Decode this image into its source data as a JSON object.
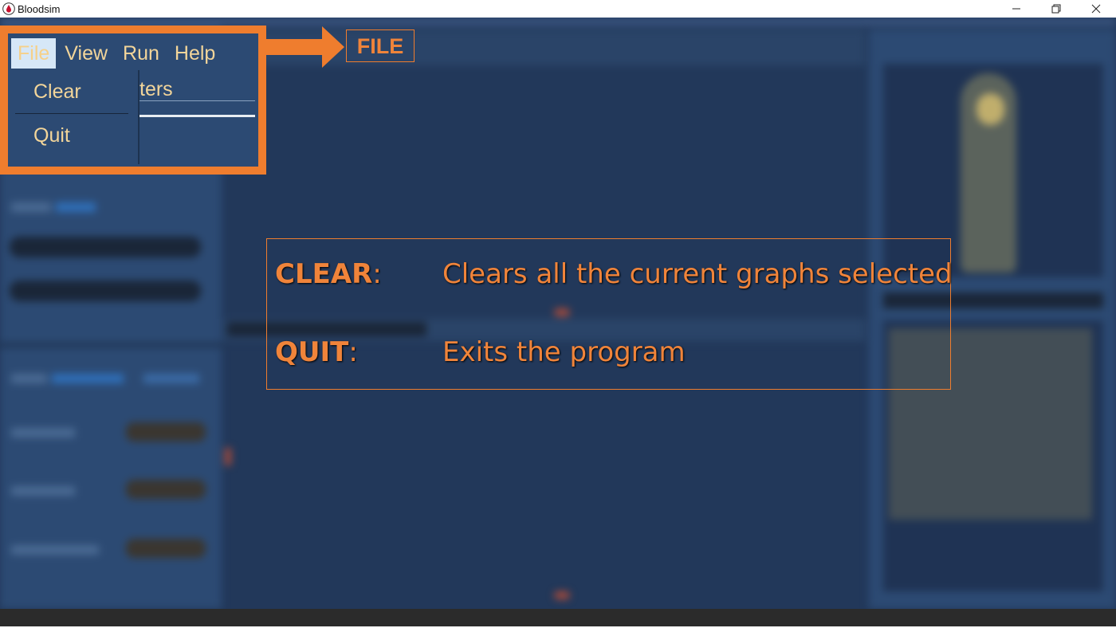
{
  "window": {
    "title": "Bloodsim",
    "controls": [
      "minimize-icon",
      "restore-icon",
      "close-icon"
    ]
  },
  "menubar": {
    "items": [
      {
        "label": "File",
        "active": true
      },
      {
        "label": "View",
        "active": false
      },
      {
        "label": "Run",
        "active": false
      },
      {
        "label": "Help",
        "active": false
      }
    ]
  },
  "file_menu": {
    "items": [
      "Clear",
      "Quit"
    ],
    "peek_text": "ters"
  },
  "callout": {
    "label": "FILE"
  },
  "info": {
    "rows": [
      {
        "key": "CLEAR",
        "sep": ":",
        "desc": "Clears all the current graphs selected"
      },
      {
        "key": "QUIT",
        "sep": ":",
        "desc": "Exits the program"
      }
    ]
  },
  "colors": {
    "accent": "#ef7d2e",
    "menu_text": "#f2d59a",
    "background": "#22385a"
  }
}
